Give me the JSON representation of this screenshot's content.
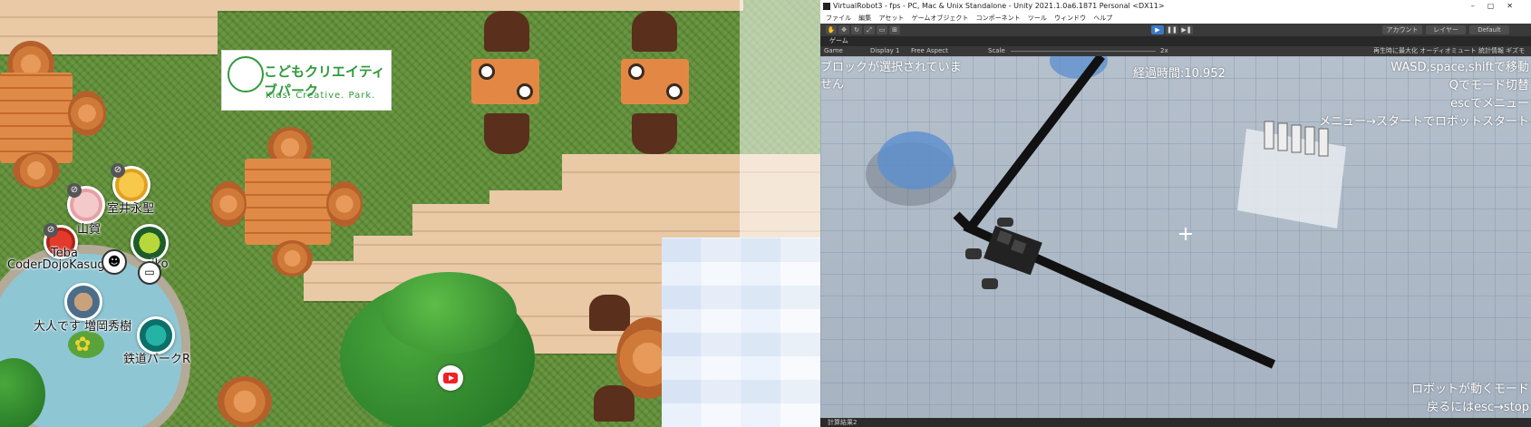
{
  "left_map": {
    "logo": {
      "title": "こどもクリエイティブパーク",
      "subtitle": "Kids. Creative. Park."
    },
    "participants": [
      {
        "name": "室井永聖"
      },
      {
        "name": "山賀"
      },
      {
        "name": "Teba"
      },
      {
        "name": "CoderDojoKasuga"
      },
      {
        "name": "iko"
      },
      {
        "name": "大人です 増岡秀樹"
      },
      {
        "name": "鉄道パークR"
      }
    ]
  },
  "unity": {
    "window_title": "VirtualRobot3 - fps - PC, Mac & Unix Standalone - Unity 2021.1.0a6.1871 Personal <DX11>",
    "window_controls": [
      "–",
      "▢",
      "✕"
    ],
    "menu": [
      "ファイル",
      "編集",
      "アセット",
      "ゲームオブジェクト",
      "コンポーネント",
      "ツール",
      "ウィンドウ",
      "ヘルプ"
    ],
    "toolbar": {
      "account_label": "アカウント",
      "layers_label": "レイヤー",
      "layout_label": "Default"
    },
    "tab_label": "ゲーム",
    "game_bar": {
      "display_mode": "Game",
      "display": "Display 1",
      "aspect": "Free Aspect",
      "scale_label": "Scale",
      "scale_value": "2x",
      "right_items": "再生時に最大化  オーディオミュート  統計情報  ギズモ"
    },
    "hud": {
      "block_msg_line1": "ブロックが選択されていま",
      "block_msg_line2": "せん",
      "elapsed": "経過時間:10.952",
      "help1": "WASD,space,shiftで移動",
      "help2": "Qでモード切替",
      "help3": "escでメニュー",
      "help4": "メニュー→スタートでロボットスタート",
      "mode1": "ロボットが動くモード",
      "mode2": "戻るにはesc→stop"
    },
    "status_text": "計算結果2"
  }
}
